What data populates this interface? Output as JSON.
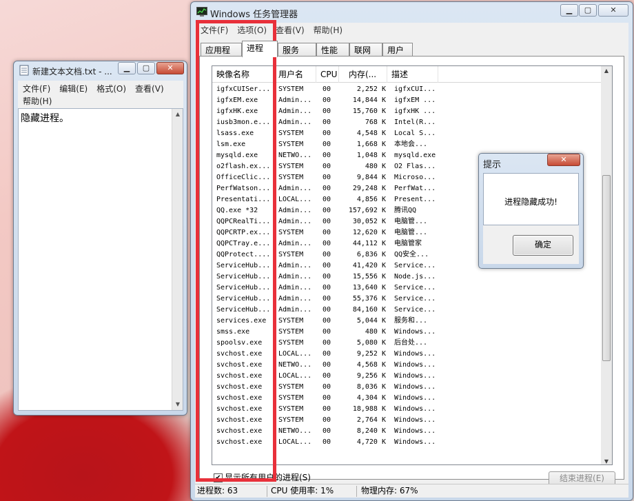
{
  "notepad": {
    "title": "新建文本文档.txt - ...",
    "menus": [
      "文件(F)",
      "编辑(E)",
      "格式(O)",
      "查看(V)",
      "帮助(H)"
    ],
    "content": "隐藏进程。"
  },
  "taskmgr": {
    "title": "Windows 任务管理器",
    "menus": [
      "文件(F)",
      "选项(O)",
      "查看(V)",
      "帮助(H)"
    ],
    "tabs": [
      "应用程序",
      "进程",
      "服务",
      "性能",
      "联网",
      "用户"
    ],
    "active_tab": "进程",
    "columns": [
      "映像名称",
      "用户名",
      "CPU",
      "内存(...",
      "描述"
    ],
    "rows": [
      [
        "igfxCUISer...",
        "SYSTEM",
        "00",
        "2,252 K",
        "igfxCUI..."
      ],
      [
        "igfxEM.exe",
        "Admin...",
        "00",
        "14,844 K",
        "igfxEM ..."
      ],
      [
        "igfxHK.exe",
        "Admin...",
        "00",
        "15,760 K",
        "igfxHK ..."
      ],
      [
        "iusb3mon.e...",
        "Admin...",
        "00",
        "768 K",
        "Intel(R..."
      ],
      [
        "lsass.exe",
        "SYSTEM",
        "00",
        "4,548 K",
        "Local S..."
      ],
      [
        "lsm.exe",
        "SYSTEM",
        "00",
        "1,668 K",
        "本地会..."
      ],
      [
        "mysqld.exe",
        "NETWO...",
        "00",
        "1,048 K",
        "mysqld.exe"
      ],
      [
        "o2flash.ex...",
        "SYSTEM",
        "00",
        "480 K",
        "O2 Flas..."
      ],
      [
        "OfficeClic...",
        "SYSTEM",
        "00",
        "9,844 K",
        "Microso..."
      ],
      [
        "PerfWatson...",
        "Admin...",
        "00",
        "29,248 K",
        "PerfWat..."
      ],
      [
        "Presentati...",
        "LOCAL...",
        "00",
        "4,856 K",
        "Present..."
      ],
      [
        "QQ.exe *32",
        "Admin...",
        "00",
        "157,692 K",
        "腾讯QQ"
      ],
      [
        "QQPCRealTi...",
        "Admin...",
        "00",
        "30,052 K",
        "电脑管..."
      ],
      [
        "QQPCRTP.ex...",
        "SYSTEM",
        "00",
        "12,620 K",
        "电脑管..."
      ],
      [
        "QQPCTray.e...",
        "Admin...",
        "00",
        "44,112 K",
        "电脑管家"
      ],
      [
        "QQProtect....",
        "SYSTEM",
        "00",
        "6,836 K",
        "QQ安全..."
      ],
      [
        "ServiceHub...",
        "Admin...",
        "00",
        "41,420 K",
        "Service..."
      ],
      [
        "ServiceHub...",
        "Admin...",
        "00",
        "15,556 K",
        "Node.js..."
      ],
      [
        "ServiceHub...",
        "Admin...",
        "00",
        "13,640 K",
        "Service..."
      ],
      [
        "ServiceHub...",
        "Admin...",
        "00",
        "55,376 K",
        "Service..."
      ],
      [
        "ServiceHub...",
        "Admin...",
        "00",
        "84,160 K",
        "Service..."
      ],
      [
        "services.exe",
        "SYSTEM",
        "00",
        "5,044 K",
        "服务和..."
      ],
      [
        "smss.exe",
        "SYSTEM",
        "00",
        "480 K",
        "Windows..."
      ],
      [
        "spoolsv.exe",
        "SYSTEM",
        "00",
        "5,080 K",
        "后台处..."
      ],
      [
        "svchost.exe",
        "LOCAL...",
        "00",
        "9,252 K",
        "Windows..."
      ],
      [
        "svchost.exe",
        "NETWO...",
        "00",
        "4,568 K",
        "Windows..."
      ],
      [
        "svchost.exe",
        "LOCAL...",
        "00",
        "9,256 K",
        "Windows..."
      ],
      [
        "svchost.exe",
        "SYSTEM",
        "00",
        "8,036 K",
        "Windows..."
      ],
      [
        "svchost.exe",
        "SYSTEM",
        "00",
        "4,304 K",
        "Windows..."
      ],
      [
        "svchost.exe",
        "SYSTEM",
        "00",
        "18,988 K",
        "Windows..."
      ],
      [
        "svchost.exe",
        "SYSTEM",
        "00",
        "2,764 K",
        "Windows..."
      ],
      [
        "svchost.exe",
        "NETWO...",
        "00",
        "8,240 K",
        "Windows..."
      ],
      [
        "svchost.exe",
        "LOCAL...",
        "00",
        "4,720 K",
        "Windows..."
      ]
    ],
    "show_all_label": "显示所有用户的进程(S)",
    "show_all_checked": true,
    "end_process_label": "结束进程(E)",
    "status": {
      "process_count": "进程数: 63",
      "cpu_usage": "CPU 使用率: 1%",
      "physical_memory": "物理内存: 67%"
    }
  },
  "dialog": {
    "title": "提示",
    "message": "进程隐藏成功!",
    "ok_label": "确定"
  },
  "highlight_color": "#e8303a"
}
